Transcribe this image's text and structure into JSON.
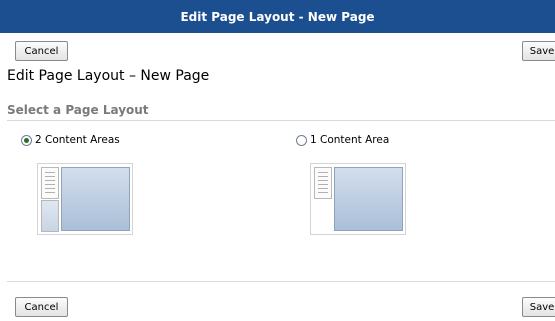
{
  "window": {
    "title": "Edit Page Layout - New Page"
  },
  "toolbar_top": {
    "cancel_label": "Cancel",
    "save_label": "Save"
  },
  "page": {
    "title": "Edit Page Layout – New Page"
  },
  "section": {
    "title": "Select a Page Layout"
  },
  "layouts": [
    {
      "label": "2 Content Areas",
      "selected": true
    },
    {
      "label": "1 Content Area",
      "selected": false
    }
  ],
  "toolbar_bottom": {
    "cancel_label": "Cancel",
    "save_label": "Save"
  },
  "colors": {
    "titlebar": "#1c4f8f",
    "preview_fill": "#aabfd8",
    "radio_selected": "#2a6e2a"
  }
}
